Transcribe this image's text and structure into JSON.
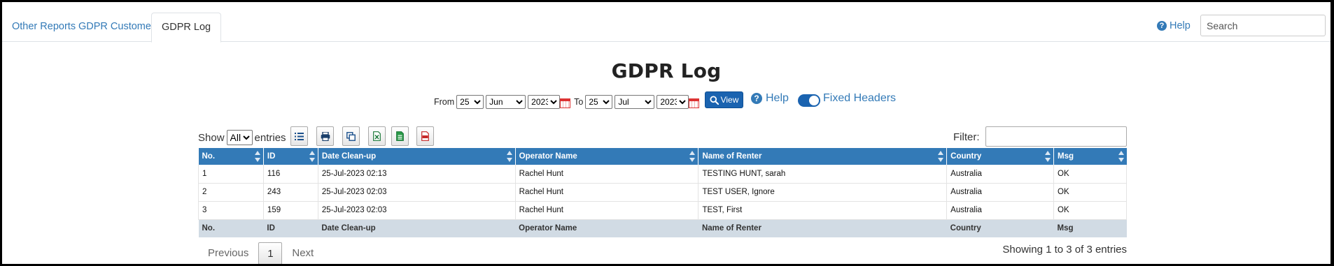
{
  "tabs": [
    {
      "label": "Other Reports"
    },
    {
      "label": "GDPR Customers"
    },
    {
      "label": "GDPR Log"
    }
  ],
  "top": {
    "help_label": "Help",
    "search_placeholder": "Search"
  },
  "title": "GDPR Log",
  "date_filter": {
    "from_label": "From",
    "to_label": "To",
    "from_day": "25",
    "from_month": "Jun",
    "from_year": "2023",
    "to_day": "25",
    "to_month": "Jul",
    "to_year": "2023",
    "view_label": "View",
    "help_label": "Help",
    "fixed_headers_label": "Fixed Headers",
    "fixed_headers_on": true
  },
  "controls": {
    "show_label": "Show",
    "entries_value": "All",
    "entries_label": "entries",
    "filter_label": "Filter:"
  },
  "table": {
    "columns": [
      "No.",
      "ID",
      "Date Clean-up",
      "Operator Name",
      "Name of Renter",
      "Country",
      "Msg"
    ],
    "rows": [
      [
        "1",
        "116",
        "25-Jul-2023 02:13",
        "Rachel Hunt",
        "TESTING HUNT, sarah",
        "Australia",
        "OK"
      ],
      [
        "2",
        "243",
        "25-Jul-2023 02:03",
        "Rachel Hunt",
        "TEST USER, Ignore",
        "Australia",
        "OK"
      ],
      [
        "3",
        "159",
        "25-Jul-2023 02:03",
        "Rachel Hunt",
        "TEST, First",
        "Australia",
        "OK"
      ]
    ]
  },
  "pagination": {
    "previous_label": "Previous",
    "current_page": "1",
    "next_label": "Next",
    "info": "Showing 1 to 3 of 3 entries"
  },
  "colors": {
    "accent": "#337ab7",
    "header_bg": "#337ab7",
    "footer_bg": "#d1dbe4",
    "button_blue": "#1a63b0"
  }
}
